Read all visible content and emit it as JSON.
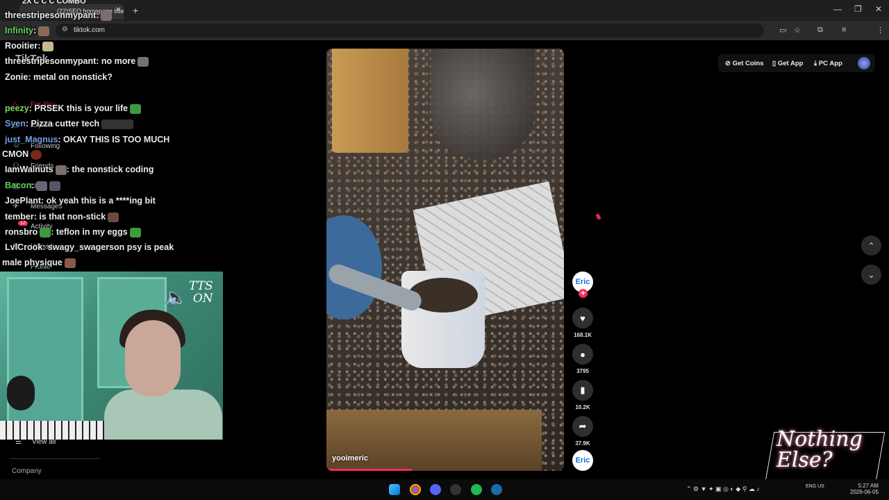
{
  "browser": {
    "tab_title": "(22)SEO homepage title",
    "url": "tiktok.com",
    "top_text": "2X C C C COMBO"
  },
  "sidebar": {
    "logo": "TikTok",
    "items": [
      {
        "label": "For You"
      },
      {
        "label": "Explore"
      },
      {
        "label": "Following"
      },
      {
        "label": "Friends"
      },
      {
        "label": "LIVE"
      },
      {
        "label": "Messages"
      },
      {
        "label": "Activity",
        "badge": "12"
      },
      {
        "label": "Upload"
      },
      {
        "label": "Profile"
      }
    ],
    "view_all": "View all",
    "company": "Company"
  },
  "chat": [
    {
      "user": "threestripesonmypant",
      "text": ":",
      "color": "#eaeaea"
    },
    {
      "user": "Infinity",
      "text": ":",
      "color": "#5ed35e"
    },
    {
      "user": "Rooitier",
      "text": ":",
      "color": "#eaeaea"
    },
    {
      "user": "threestripesonmypant",
      "text": ": no more",
      "color": "#eaeaea"
    },
    {
      "user": "Zonie",
      "text": ": metal on nonstick?",
      "color": "#eaeaea"
    },
    {
      "user": "peezy",
      "text": ": PRSEK this is your life",
      "color": "#7fd860"
    },
    {
      "user": "Syen",
      "text": ": Pizza cutter tech",
      "color": "#6fa0e8"
    },
    {
      "user": "just_Magnus",
      "text": ": OKAY THIS IS TOO MUCH",
      "color": "#6fa0e8"
    },
    {
      "user": "",
      "text": "CMON",
      "color": "#eaeaea"
    },
    {
      "user": "IamWalnuts",
      "text": ": the nonstick coding",
      "color": "#eaeaea"
    },
    {
      "user": "Bacon",
      "text": ":",
      "color": "#5ed35e"
    },
    {
      "user": "JoePlant",
      "text": ": ok yeah this is a ****ing bit",
      "color": "#eaeaea"
    },
    {
      "user": "tember",
      "text": ": is that non-stick",
      "color": "#eaeaea"
    },
    {
      "user": "ronsbro",
      "text": ": teflon in my eggs",
      "color": "#eaeaea"
    },
    {
      "user": "LvlCrook",
      "text": ": swagy_swagerson psy is peak",
      "color": "#eaeaea"
    },
    {
      "user": "",
      "text": "male physique",
      "color": "#eaeaea"
    }
  ],
  "webcam": {
    "tts_line1": "TTS",
    "tts_line2": "ON"
  },
  "video": {
    "username": "yooimeric"
  },
  "actions": {
    "creator_avatar": "Eric",
    "likes": "168.1K",
    "comments": "3795",
    "saves": "10.2K",
    "shares": "37.9K",
    "music_avatar": "Eric"
  },
  "top_buttons": {
    "get_coins": "Get Coins",
    "get_app": "Get App",
    "pc_app": "PC App"
  },
  "watermark": "Nothing Else?",
  "taskbar": {
    "lang": "ENG US",
    "time": "5:27 AM",
    "date": "2026-06-05"
  },
  "colors": {
    "accent": "#fe2c55",
    "link": "#1670d8"
  }
}
